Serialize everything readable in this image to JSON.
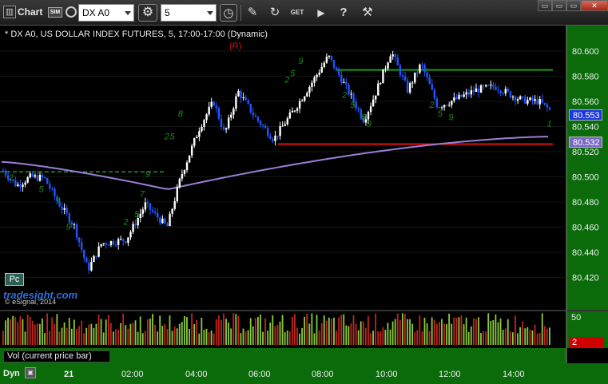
{
  "toolbar": {
    "app_title": "Chart",
    "symbol_type_icon": "sim-icon",
    "symbol_type_text": "SIM",
    "symbol": "DX A0",
    "interval": "5",
    "tools": [
      {
        "name": "gear-icon",
        "glyph": "⚙"
      },
      {
        "name": "clock-icon",
        "glyph": "◷"
      },
      {
        "name": "pencil-icon",
        "glyph": "✎"
      },
      {
        "name": "refresh-icon",
        "glyph": "↻"
      },
      {
        "name": "get-icon",
        "glyph": "GET"
      },
      {
        "name": "play-icon",
        "glyph": "▶"
      },
      {
        "name": "help-icon",
        "glyph": "?"
      },
      {
        "name": "tools-icon",
        "glyph": "⚒"
      }
    ],
    "window_buttons": [
      "▭",
      "▭",
      "▭",
      "✕"
    ]
  },
  "chart": {
    "header": "* DX A0, US DOLLAR INDEX FUTURES, 5, 17:00-17:00 (Dynamic)",
    "marker": "(R)",
    "last_price": "80.553",
    "ma_price": "80.532",
    "pc_label": "Pc",
    "watermark": "tradesight.com",
    "copyright": "© eSignal, 2014",
    "volume_label": "Vol (current price bar)",
    "volume_max": "50",
    "volume_current": "2",
    "dyn_label": "Dyn",
    "colors": {
      "up": "#ffffff",
      "down": "#2255ff",
      "ma": "#9a7fd6",
      "resistance": "#1e9a1e",
      "support": "#e01010",
      "counter": "#1d8c1d"
    }
  },
  "chart_data": {
    "type": "candlestick",
    "price_ticks": [
      "80.600",
      "80.580",
      "80.560",
      "80.540",
      "80.520",
      "80.500",
      "80.480",
      "80.460",
      "80.440",
      "80.420"
    ],
    "time_ticks": [
      "21",
      "02:00",
      "04:00",
      "06:00",
      "08:00",
      "10:00",
      "12:00",
      "14:00"
    ],
    "price_range": [
      80.412,
      80.612
    ],
    "volume_ticks": [
      "50",
      "2"
    ],
    "levels": [
      {
        "price": 80.504,
        "style": "dashed",
        "color": "#1e9a1e"
      },
      {
        "price": 80.585,
        "style": "solid",
        "color": "#1e9a1e"
      },
      {
        "price": 80.526,
        "style": "solid",
        "color": "#e01010"
      }
    ],
    "close_path": [
      [
        0,
        80.505
      ],
      [
        0.5,
        80.493
      ],
      [
        1.0,
        80.5
      ],
      [
        1.5,
        80.499
      ],
      [
        2.0,
        80.48
      ],
      [
        2.6,
        80.461
      ],
      [
        3.1,
        80.426
      ],
      [
        3.6,
        80.447
      ],
      [
        4.5,
        80.45
      ],
      [
        5.2,
        80.478
      ],
      [
        6.0,
        80.46
      ],
      [
        6.5,
        80.5
      ],
      [
        7.2,
        80.54
      ],
      [
        7.7,
        80.56
      ],
      [
        8.1,
        80.534
      ],
      [
        8.6,
        80.568
      ],
      [
        9.2,
        80.548
      ],
      [
        9.9,
        80.53
      ],
      [
        10.7,
        80.555
      ],
      [
        11.3,
        80.575
      ],
      [
        11.9,
        80.596
      ],
      [
        12.7,
        80.565
      ],
      [
        13.2,
        80.545
      ],
      [
        13.6,
        80.565
      ],
      [
        14.2,
        80.6
      ],
      [
        14.8,
        80.569
      ],
      [
        15.3,
        80.59
      ],
      [
        15.9,
        80.556
      ],
      [
        16.6,
        80.562
      ],
      [
        17.3,
        80.569
      ],
      [
        18.0,
        80.572
      ],
      [
        18.6,
        80.565
      ],
      [
        19.0,
        80.561
      ],
      [
        19.6,
        80.56
      ],
      [
        20.0,
        80.553
      ]
    ]
  }
}
